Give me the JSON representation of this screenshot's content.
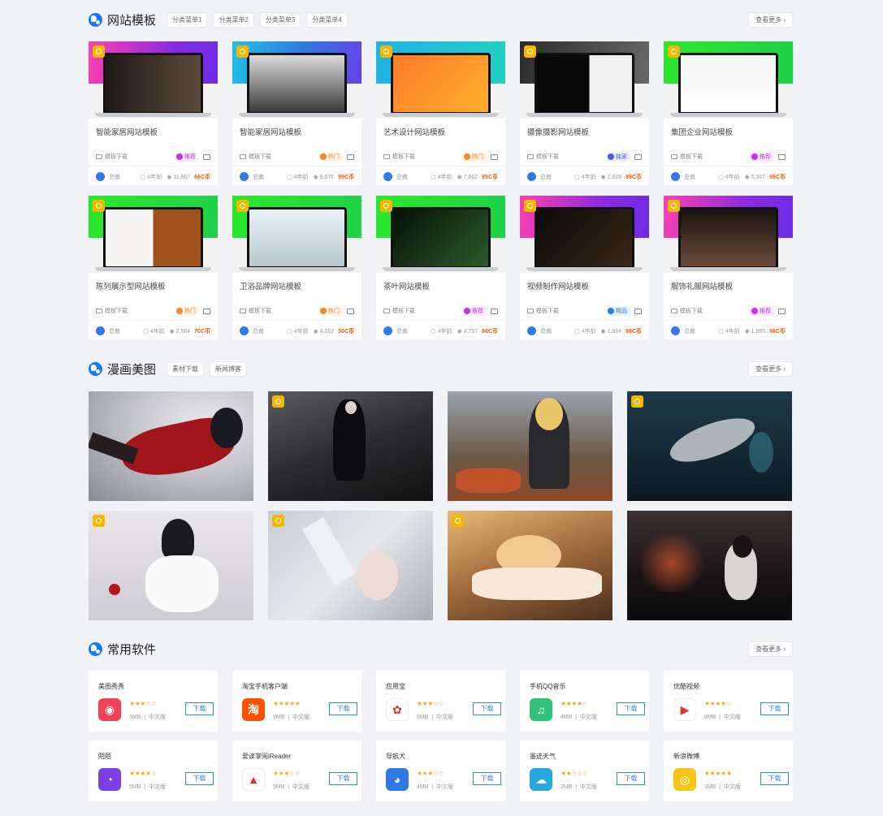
{
  "sections": {
    "templates": {
      "title": "网站模板",
      "chips": [
        "分类菜单1",
        "分类菜单2",
        "分类菜单3",
        "分类菜单4"
      ],
      "more": "查看更多",
      "cards": [
        {
          "name": "智能家居网站模板",
          "category": "模板下载",
          "badge": "推荐",
          "badge_color": "#c534e8",
          "user": "总裁",
          "time": "4年前",
          "views": "11,967",
          "price": "66C币"
        },
        {
          "name": "智能家居网站模板",
          "category": "模板下载",
          "badge": "热门",
          "badge_color": "#f08a24",
          "user": "总裁",
          "time": "4年前",
          "views": "9,676",
          "price": "99C币"
        },
        {
          "name": "艺术设计网站模板",
          "category": "模板下载",
          "badge": "热门",
          "badge_color": "#f08a24",
          "user": "总裁",
          "time": "4年前",
          "views": "7,662",
          "price": "85C币"
        },
        {
          "name": "摄像摄影网站模板",
          "category": "模板下载",
          "badge": "独家",
          "badge_color": "#4a5de8",
          "user": "总裁",
          "time": "4年前",
          "views": "2,928",
          "price": "89C币"
        },
        {
          "name": "集团企业网站模板",
          "category": "模板下载",
          "badge": "推荐",
          "badge_color": "#c534e8",
          "user": "总裁",
          "time": "4年前",
          "views": "5,307",
          "price": "99C币"
        },
        {
          "name": "陈列展示型网站模板",
          "category": "模板下载",
          "badge": "热门",
          "badge_color": "#f08a24",
          "user": "总裁",
          "time": "4年前",
          "views": "2,564",
          "price": "70C币"
        },
        {
          "name": "卫浴品牌网站模板",
          "category": "模板下载",
          "badge": "热门",
          "badge_color": "#f08a24",
          "user": "总裁",
          "time": "4年前",
          "views": "4,052",
          "price": "30C币"
        },
        {
          "name": "茶叶网站模板",
          "category": "模板下载",
          "badge": "推荐",
          "badge_color": "#c534e8",
          "user": "总裁",
          "time": "4年前",
          "views": "4,757",
          "price": "66C币"
        },
        {
          "name": "视频制作网站模板",
          "category": "模板下载",
          "badge": "精品",
          "badge_color": "#2f7ae5",
          "user": "总裁",
          "time": "4年前",
          "views": "2,654",
          "price": "98C币"
        },
        {
          "name": "服饰礼服网站模板",
          "category": "模板下载",
          "badge": "推荐",
          "badge_color": "#c534e8",
          "user": "总裁",
          "time": "4年前",
          "views": "1,885",
          "price": "66C币"
        }
      ]
    },
    "comics": {
      "title": "漫画美图",
      "chips": [
        "素材下载",
        "新闻博客"
      ],
      "more": "查看更多"
    },
    "software": {
      "title": "常用软件",
      "more": "查看更多",
      "download_label": "下载",
      "items": [
        {
          "name": "美图秀秀",
          "stars": "★★★☆☆",
          "size": "3MB",
          "lang": "中文版",
          "icon": "meitu-icon",
          "color": "#f0425a",
          "glyph": "◉"
        },
        {
          "name": "淘宝手机客户端",
          "stars": "★★★★★",
          "size": "9MB",
          "lang": "中文版",
          "icon": "taobao-icon",
          "color": "#ff5000",
          "glyph": "淘"
        },
        {
          "name": "应用宝",
          "stars": "★★★☆☆",
          "size": "5MB",
          "lang": "中文版",
          "icon": "yingyongbao-icon",
          "color": "#ffffff",
          "glyph": "✿"
        },
        {
          "name": "手机QQ音乐",
          "stars": "★★★★☆",
          "size": "4MB",
          "lang": "中文版",
          "icon": "qqmusic-icon",
          "color": "#31c27c",
          "glyph": "♫"
        },
        {
          "name": "优酷视频",
          "stars": "★★★★☆",
          "size": "8MB",
          "lang": "中文版",
          "icon": "youku-icon",
          "color": "#ffffff",
          "glyph": "▶"
        },
        {
          "name": "陌陌",
          "stars": "★★★★☆",
          "size": "5MB",
          "lang": "中文版",
          "icon": "momo-icon",
          "color": "#7b3fe4",
          "glyph": "◔"
        },
        {
          "name": "爱读掌阅iReader",
          "stars": "★★★☆☆",
          "size": "5MB",
          "lang": "中文版",
          "icon": "ireader-icon",
          "color": "#ffffff",
          "glyph": "▲"
        },
        {
          "name": "导航犬",
          "stars": "★★★☆☆",
          "size": "4MB",
          "lang": "中文版",
          "icon": "daohangquan-icon",
          "color": "#2f7ae5",
          "glyph": "◕"
        },
        {
          "name": "墨迹天气",
          "stars": "★★☆☆☆",
          "size": "2MB",
          "lang": "中文版",
          "icon": "mojitianqi-icon",
          "color": "#29a8e0",
          "glyph": "☁"
        },
        {
          "name": "新浪微博",
          "stars": "★★★★★",
          "size": "3MB",
          "lang": "中文版",
          "icon": "weibo-icon",
          "color": "#f5c518",
          "glyph": "◎"
        }
      ]
    }
  }
}
